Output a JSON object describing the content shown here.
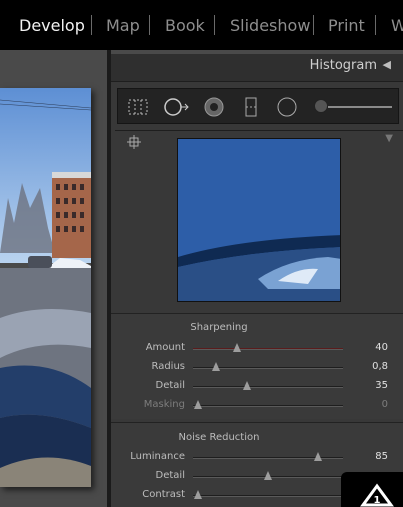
{
  "modules": [
    {
      "label": "Develop",
      "active": true
    },
    {
      "label": "Map",
      "active": false
    },
    {
      "label": "Book",
      "active": false
    },
    {
      "label": "Slideshow",
      "active": false
    },
    {
      "label": "Print",
      "active": false
    },
    {
      "label": "W",
      "active": false
    }
  ],
  "histogram": {
    "title": "Histogram",
    "collapse_arrow": "◀"
  },
  "toolstrip": {
    "tools": [
      "crop-overlay-tool",
      "spot-removal-tool",
      "red-eye-tool",
      "graduated-filter-tool",
      "radial-filter-tool",
      "adjustment-brush-tool"
    ]
  },
  "sharpening": {
    "title": "Sharpening",
    "rows": [
      {
        "label": "Amount",
        "value": "40",
        "position": 0.29,
        "dim": false
      },
      {
        "label": "Radius",
        "value": "0,8",
        "position": 0.15,
        "dim": false
      },
      {
        "label": "Detail",
        "value": "35",
        "position": 0.36,
        "dim": false
      },
      {
        "label": "Masking",
        "value": "0",
        "position": 0.03,
        "dim": true
      }
    ]
  },
  "noise_reduction": {
    "title": "Noise Reduction",
    "rows": [
      {
        "label": "Luminance",
        "value": "85",
        "position": 0.83,
        "dim": false
      },
      {
        "label": "Detail",
        "value": "",
        "position": 0.5,
        "dim": false
      },
      {
        "label": "Contrast",
        "value": "",
        "position": 0.03,
        "dim": false
      }
    ]
  },
  "colors": {
    "topbar_bg": "#000000",
    "active_module": "#f2f2f2",
    "inactive_module": "#8e8e8e",
    "panel_bg": "#383838",
    "amount_track_accent": "#5a1c1c"
  }
}
